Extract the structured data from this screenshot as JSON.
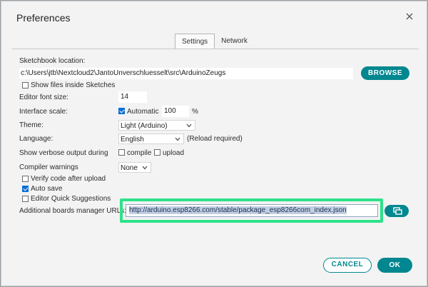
{
  "dialog": {
    "title": "Preferences"
  },
  "tabs": [
    {
      "label": "Settings",
      "active": true
    },
    {
      "label": "Network",
      "active": false
    }
  ],
  "sketchbook": {
    "label": "Sketchbook location:",
    "path": "c:\\Users\\jtb\\Nextcloud2\\JantoUnverschluesselt\\src\\ArduinoZeugs",
    "browse_label": "BROWSE",
    "show_files_label": "Show files inside Sketches",
    "show_files_checked": false
  },
  "editor_font": {
    "label": "Editor font size:",
    "value": "14"
  },
  "interface_scale": {
    "label": "Interface scale:",
    "automatic_label": "Automatic",
    "automatic_checked": true,
    "value": "100",
    "unit": "%"
  },
  "theme": {
    "label": "Theme:",
    "value": "Light (Arduino)"
  },
  "language": {
    "label": "Language:",
    "value": "English",
    "note": "(Reload required)"
  },
  "verbose": {
    "label": "Show verbose output during",
    "compile_label": "compile",
    "compile_checked": false,
    "upload_label": "upload",
    "upload_checked": false
  },
  "compiler_warnings": {
    "label": "Compiler warnings",
    "value": "None"
  },
  "options": {
    "verify_label": "Verify code after upload",
    "verify_checked": false,
    "autosave_label": "Auto save",
    "autosave_checked": true,
    "quick_suggestions_label": "Editor Quick Suggestions",
    "quick_suggestions_checked": false
  },
  "boards_manager": {
    "label": "Additional boards manager URLs:",
    "url": "http://arduino.esp8266.com/stable/package_esp8266com_index.json"
  },
  "footer": {
    "cancel_label": "CANCEL",
    "ok_label": "OK"
  },
  "colors": {
    "accent": "#00878f",
    "highlight": "#2ee28a",
    "checkbox": "#0a6fd6"
  },
  "icons": {
    "close": "close-icon",
    "open_window": "open-window-icon",
    "chevron": "chevron-down-icon"
  }
}
